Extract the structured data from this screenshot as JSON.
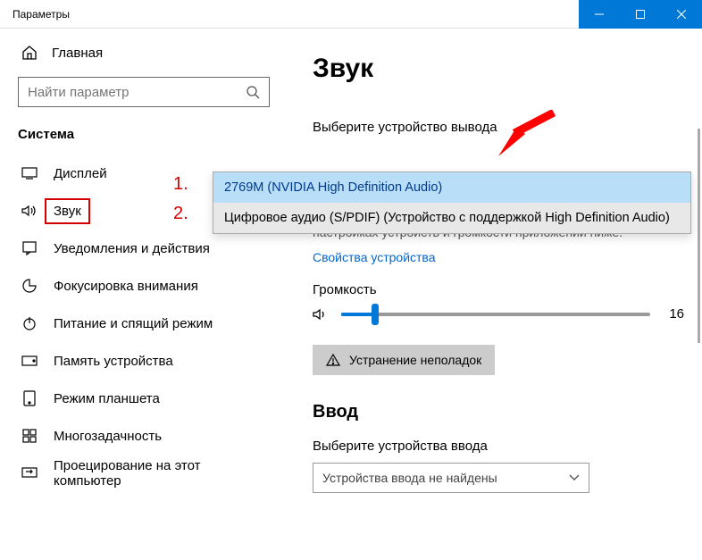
{
  "titlebar": {
    "title": "Параметры"
  },
  "sidebar": {
    "home": "Главная",
    "search_placeholder": "Найти параметр",
    "group": "Система",
    "items": [
      {
        "label": "Дисплей"
      },
      {
        "label": "Звук"
      },
      {
        "label": "Уведомления и действия"
      },
      {
        "label": "Фокусировка внимания"
      },
      {
        "label": "Питание и спящий режим"
      },
      {
        "label": "Память устройства"
      },
      {
        "label": "Режим планшета"
      },
      {
        "label": "Многозадачность"
      },
      {
        "label": "Проецирование на этот компьютер"
      }
    ]
  },
  "main": {
    "title": "Звук",
    "output_label": "Выберите устройство вывода",
    "dropdown": {
      "opt1": "2769M (NVIDIA High Definition Audio)",
      "opt2": "Цифровое аудио (S/PDIF) (Устройство с поддержкой High Definition Audio)"
    },
    "desc": "параметры вывода. Вы можете персонализировать их в настройках устройств и громкости приложений ниже.",
    "props_link": "Свойства устройства",
    "volume_label": "Громкость",
    "volume_value": "16",
    "troubleshoot": "Устранение неполадок",
    "input_header": "Ввод",
    "input_label": "Выберите устройства ввода",
    "input_select": "Устройства ввода не найдены"
  },
  "annotations": {
    "n1": "1.",
    "n2": "2."
  }
}
